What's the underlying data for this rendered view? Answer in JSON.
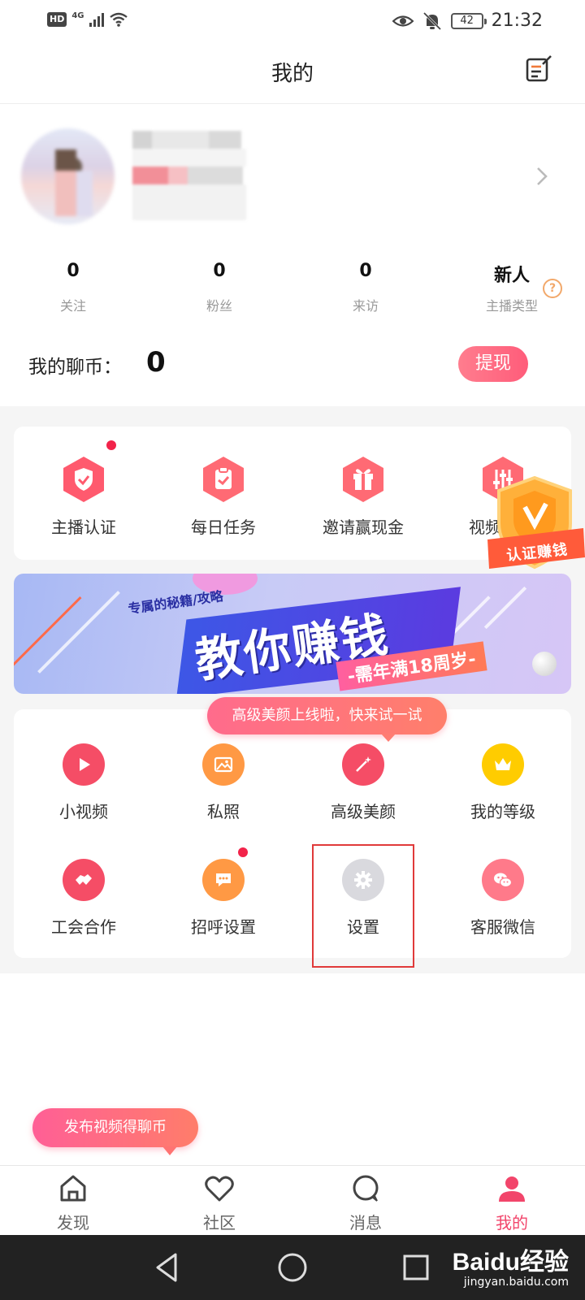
{
  "status_bar": {
    "hd": "HD",
    "network": "4G",
    "battery": "42",
    "time": "21:32"
  },
  "header": {
    "title": "我的"
  },
  "stats": [
    {
      "value": "0",
      "label": "关注"
    },
    {
      "value": "0",
      "label": "粉丝"
    },
    {
      "value": "0",
      "label": "来访"
    },
    {
      "value": "新人",
      "label": "主播类型"
    }
  ],
  "help_glyph": "?",
  "coins": {
    "label": "我的聊币：",
    "value": "0",
    "withdraw_label": "提现"
  },
  "features": [
    {
      "label": "主播认证",
      "icon": "shield-check-icon",
      "color": "#ff5a6e",
      "has_dot": true
    },
    {
      "label": "每日任务",
      "icon": "clipboard-check-icon",
      "color": "#ff6a74",
      "has_dot": false
    },
    {
      "label": "邀请赢现金",
      "icon": "gift-icon",
      "color": "#ff6a74",
      "has_dot": false
    },
    {
      "label": "视频",
      "icon": "sliders-icon",
      "color": "#ff6a74",
      "has_dot": false
    }
  ],
  "certify_badge": {
    "text": "认证赚钱"
  },
  "banner": {
    "kicker": "专属的秘籍/攻略",
    "title": "教你赚钱",
    "subtitle": "-需年满18周岁-"
  },
  "tooltip_beauty": "高级美颜上线啦，快来试一试",
  "tools": [
    {
      "label": "小视频",
      "icon": "play-icon",
      "color": "#f54d66",
      "has_dot": false
    },
    {
      "label": "私照",
      "icon": "image-icon",
      "color": "#ff9944",
      "has_dot": false
    },
    {
      "label": "高级美颜",
      "icon": "magic-wand-icon",
      "color": "#f54d66",
      "has_dot": false
    },
    {
      "label": "我的等级",
      "icon": "crown-icon",
      "color": "#ffcc00",
      "has_dot": false
    },
    {
      "label": "工会合作",
      "icon": "handshake-icon",
      "color": "#f54d66",
      "has_dot": false
    },
    {
      "label": "招呼设置",
      "icon": "chat-bubble-icon",
      "color": "#ff9944",
      "has_dot": true
    },
    {
      "label": "设置",
      "icon": "gear-icon",
      "color": "#d9d9de",
      "has_dot": false
    },
    {
      "label": "客服微信",
      "icon": "wechat-icon",
      "color": "#ff7a8a",
      "has_dot": false
    }
  ],
  "tooltip_publish": "发布视频得聊币",
  "tabs": [
    {
      "label": "发现",
      "icon": "home-icon",
      "active": false
    },
    {
      "label": "社区",
      "icon": "heart-icon",
      "active": false
    },
    {
      "label": "消息",
      "icon": "chat-icon",
      "active": false
    },
    {
      "label": "我的",
      "icon": "person-icon",
      "active": true
    }
  ],
  "watermark": {
    "logo": "Baidu经验",
    "url": "jingyan.baidu.com"
  },
  "colors": {
    "accent": "#f2456b",
    "highlight_border": "#e03a3a"
  }
}
